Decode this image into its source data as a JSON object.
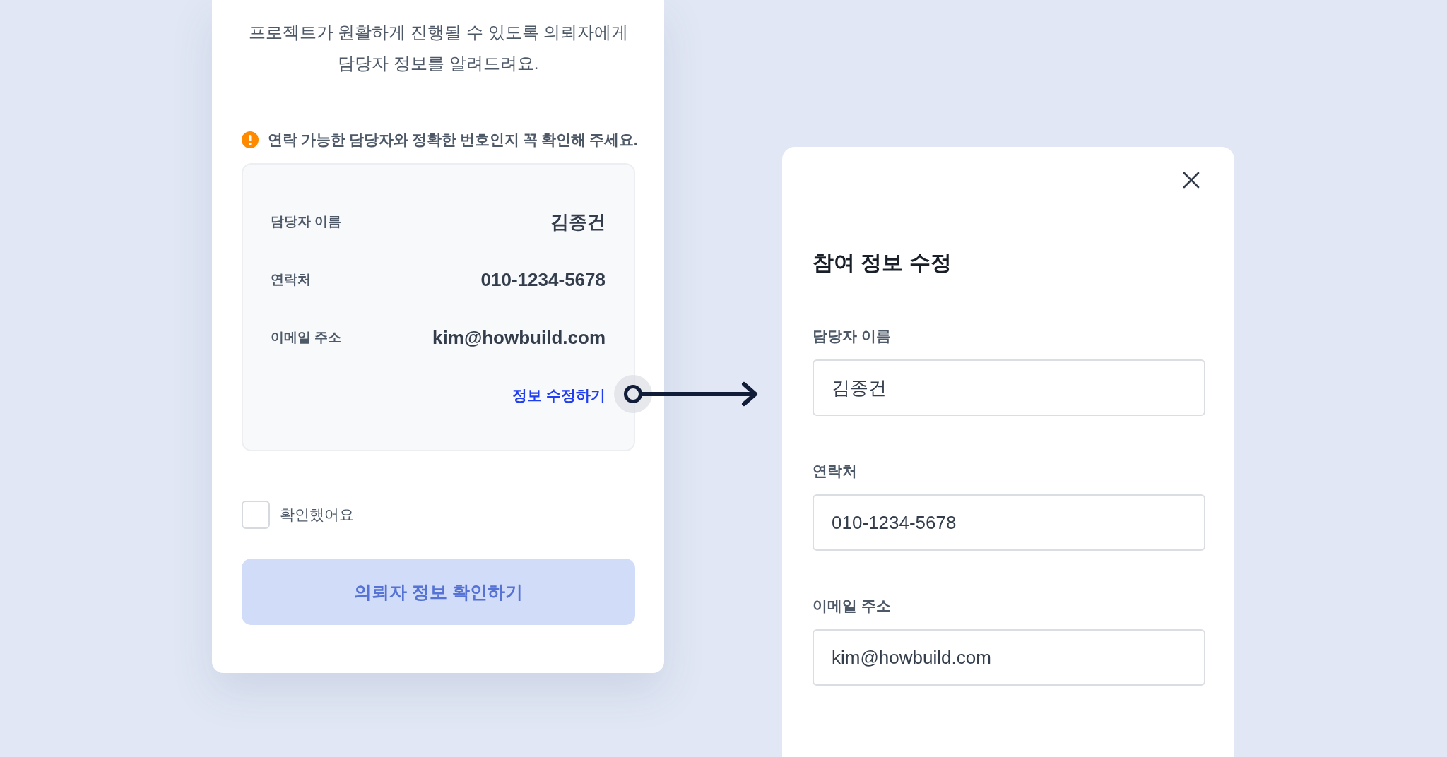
{
  "participant_card": {
    "description_lines": [
      "프로젝트가 원활하게 진행될 수 있도록 의뢰자에게",
      "담당자 정보를 알려드려요."
    ],
    "warning": "연락 가능한 담당자와 정확한 번호인지 꼭 확인해 주세요.",
    "contact_rows": [
      {
        "label": "담당자 이름",
        "value": "김종건"
      },
      {
        "label": "연락처",
        "value": "010-1234-5678"
      },
      {
        "label": "이메일 주소",
        "value": "kim@howbuild.com"
      }
    ],
    "edit_link": "정보 수정하기",
    "confirm_checkbox": {
      "label": "확인했어요",
      "checked": false
    },
    "submit_button": {
      "label": "의뢰자 정보 확인하기",
      "disabled": true
    }
  },
  "edit_dialog": {
    "title": "참여 정보 수정",
    "fields": [
      {
        "label": "담당자 이름",
        "value": "김종건"
      },
      {
        "label": "연락처",
        "value": "010-1234-5678"
      },
      {
        "label": "이메일 주소",
        "value": "kim@howbuild.com"
      }
    ]
  }
}
